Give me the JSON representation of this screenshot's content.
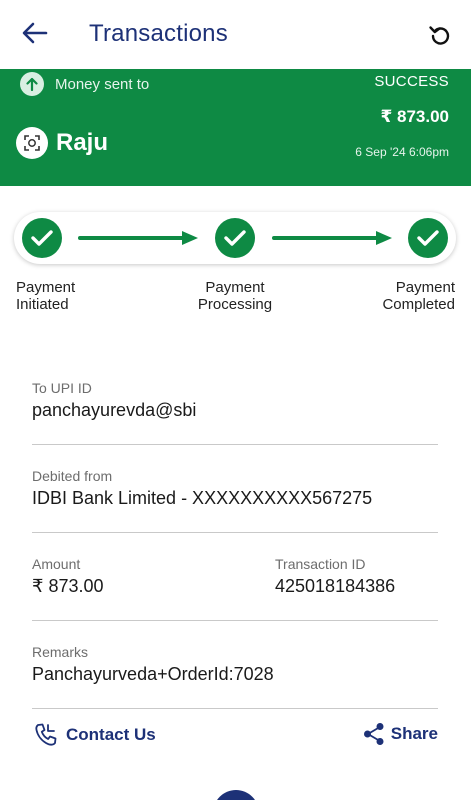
{
  "header": {
    "title": "Transactions",
    "back_icon": "arrow-left-icon",
    "refresh_icon": "refresh-icon"
  },
  "banner": {
    "sent_label": "Money sent to",
    "status": "SUCCESS",
    "amount": "₹ 873.00",
    "payee_name": "Raju",
    "datetime": "6 Sep '24 6:06pm",
    "bg_color": "#0e8a44"
  },
  "steps": [
    {
      "line1": "Payment",
      "line2": "Initiated"
    },
    {
      "line1": "Payment",
      "line2": "Processing"
    },
    {
      "line1": "Payment",
      "line2": "Completed"
    }
  ],
  "details": {
    "upi_label": "To UPI ID",
    "upi_value": "panchayurevda@sbi",
    "debited_label": "Debited from",
    "debited_value": "IDBI Bank Limited - XXXXXXXXXX567275",
    "amount_label": "Amount",
    "amount_value": "₹ 873.00",
    "txn_label": "Transaction ID",
    "txn_value": "425018184386",
    "remarks_label": "Remarks",
    "remarks_value": "Panchayurveda+OrderId:7028"
  },
  "footer": {
    "contact_label": "Contact Us",
    "share_label": "Share"
  },
  "colors": {
    "primary_navy": "#1d3177",
    "success_green": "#0e8a44"
  }
}
